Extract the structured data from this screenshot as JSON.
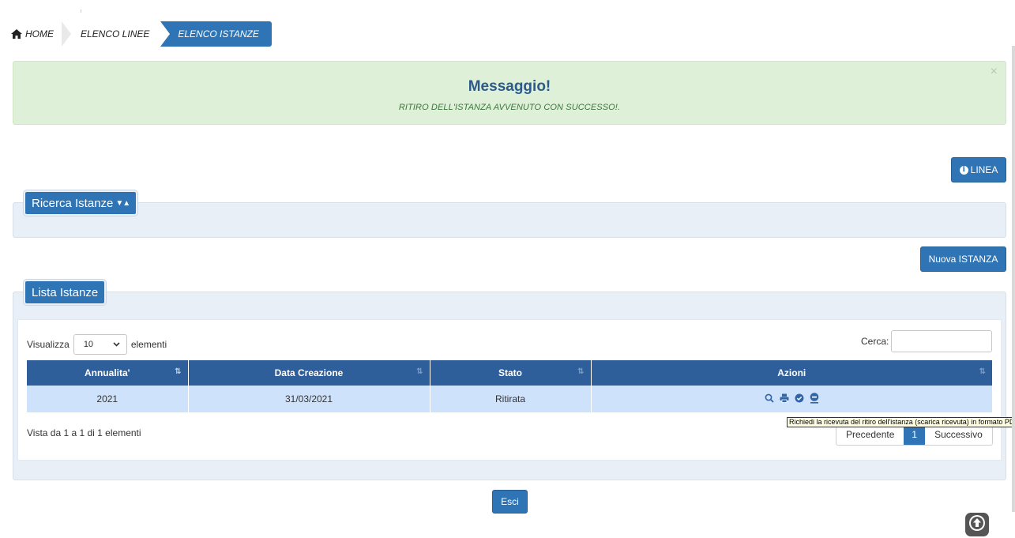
{
  "breadcrumb": {
    "home": "HOME",
    "linee": "ELENCO LINEE",
    "istanze": "ELENCO ISTANZE"
  },
  "alert": {
    "title": "Messaggio!",
    "text": "RITIRO DELL'ISTANZA AVVENUTO CON SUCCESSO!.",
    "close": "×"
  },
  "buttons": {
    "linea": "LINEA",
    "nuova": "Nuova ISTANZA",
    "esci": "Esci"
  },
  "search_panel": {
    "title": "Ricerca Istanze",
    "carets": "▼▲"
  },
  "list_panel": {
    "title": "Lista Istanze",
    "length_prefix": "Visualizza",
    "length_value": "10",
    "length_suffix": "elementi",
    "search_label": "Cerca:",
    "search_value": "",
    "columns": [
      "Annualita'",
      "Data Creazione",
      "Stato",
      "Azioni"
    ],
    "rows": [
      {
        "anno": "2021",
        "data": "31/03/2021",
        "stato": "Ritirata"
      }
    ],
    "info": "Vista da 1 a 1 di 1 elementi",
    "pager": {
      "prev": "Precedente",
      "current": "1",
      "next": "Successivo"
    },
    "tooltip": "Richiedi la ricevuta del ritiro dell'istanza (scarica ricevuta) in formato PDF"
  },
  "icons": {
    "home": "home-icon",
    "info": "info-icon",
    "search": "search-icon",
    "print": "print-icon",
    "check": "check-circle-icon",
    "download": "download-circle-icon",
    "scrolltop": "arrow-up-circle-icon"
  },
  "colors": {
    "primary": "#2f74b5",
    "table_header": "#2f5f9b",
    "row_highlight": "#cfe2fb",
    "alert_bg": "#dff0d8",
    "panel_bg": "#e9eff7"
  }
}
